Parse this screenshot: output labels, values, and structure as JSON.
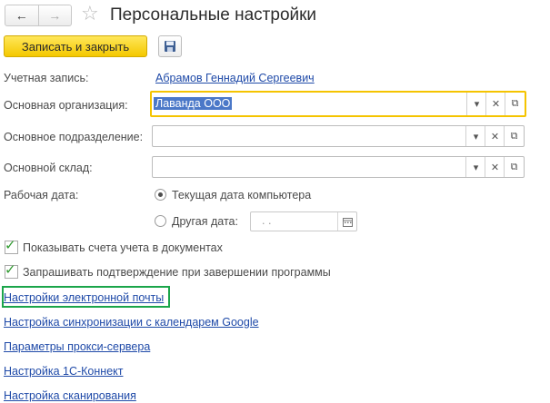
{
  "header": {
    "title": "Персональные настройки",
    "nav": {
      "back_icon": "←",
      "forward_icon": "→"
    },
    "favorite_icon": "☆"
  },
  "toolbar": {
    "save_close_label": "Записать и закрыть"
  },
  "form": {
    "account": {
      "label": "Учетная запись:",
      "value": "Абрамов Геннадий Сергеевич"
    },
    "main_org": {
      "label": "Основная организация:",
      "value": "Лаванда ООО"
    },
    "main_division": {
      "label": "Основное подразделение:",
      "value": ""
    },
    "main_warehouse": {
      "label": "Основной склад:",
      "value": ""
    },
    "work_date": {
      "label": "Рабочая дата:",
      "option_current": "Текущая дата компьютера",
      "option_other": "Другая дата:",
      "selected": "current",
      "date_value": ". ."
    },
    "checkboxes": [
      {
        "label": "Показывать счета учета в документах",
        "checked": true
      },
      {
        "label": "Запрашивать подтверждение при завершении программы",
        "checked": true
      }
    ]
  },
  "links": [
    "Настройки электронной почты",
    "Настройка синхронизации с календарем Google",
    "Параметры прокси-сервера",
    "Настройка 1С-Коннект",
    "Настройка сканирования"
  ],
  "colors": {
    "accent_yellow": "#f5c400",
    "link": "#1f4aa8",
    "highlight_green": "#1aa54a",
    "check_green": "#2f9a2f"
  }
}
